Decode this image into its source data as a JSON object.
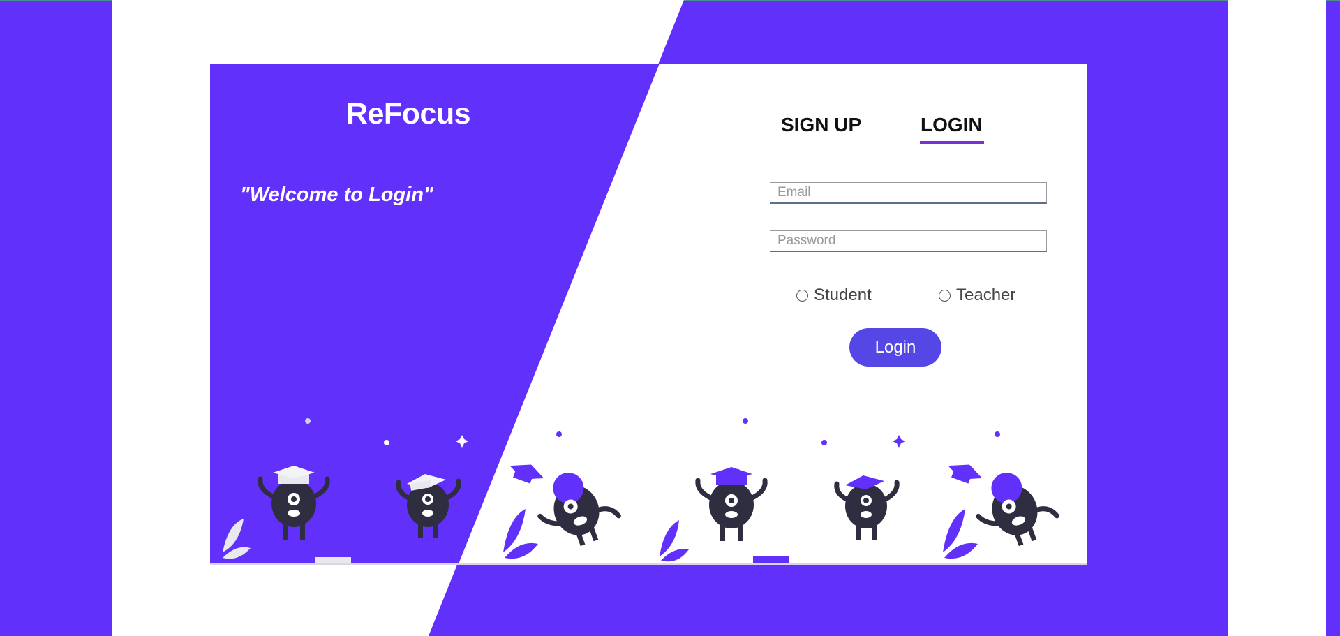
{
  "brand": {
    "name": "ReFocus",
    "tagline": "\"Welcome to Login\""
  },
  "tabs": {
    "signup": "SIGN UP",
    "login": "LOGIN",
    "active": "login"
  },
  "form": {
    "email_placeholder": "Email",
    "password_placeholder": "Password",
    "roles": [
      "Student",
      "Teacher"
    ],
    "submit_label": "Login"
  },
  "colors": {
    "primary": "#6230fb",
    "button": "#5547e6",
    "tab_underline": "#7a2fd4",
    "character": "#2f2e41"
  },
  "illustration": {
    "name": "graduation-characters",
    "icons": [
      "graduation-cap-icon",
      "leaf-icon",
      "sparkle-icon",
      "diploma-icon"
    ]
  }
}
